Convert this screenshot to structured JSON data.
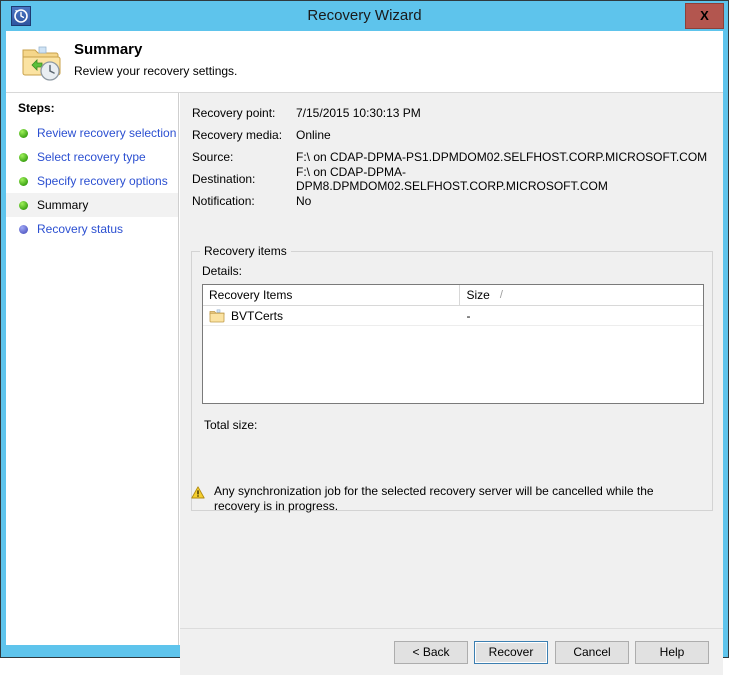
{
  "window": {
    "title": "Recovery Wizard",
    "title_icon": "recovery-clock-icon",
    "close_label": "X",
    "titlebar_color": "#5ec4ec"
  },
  "header": {
    "icon": "folder-recovery-icon",
    "title": "Summary",
    "subtitle": "Review your recovery settings."
  },
  "sidebar": {
    "heading": "Steps:",
    "items": [
      {
        "label": "Review recovery selection",
        "state": "done"
      },
      {
        "label": "Select recovery type",
        "state": "done"
      },
      {
        "label": "Specify recovery options",
        "state": "done"
      },
      {
        "label": "Summary",
        "state": "current"
      },
      {
        "label": "Recovery status",
        "state": "pending"
      }
    ]
  },
  "summary": {
    "fields": [
      {
        "label": "Recovery point:",
        "value": "7/15/2015 10:30:13 PM"
      },
      {
        "label": "Recovery media:",
        "value": "Online"
      },
      {
        "label": "Source:",
        "value": "F:\\ on CDAP-DPMA-PS1.DPMDOM02.SELFHOST.CORP.MICROSOFT.COM"
      },
      {
        "label": "Destination:",
        "value": "F:\\ on CDAP-DPMA-DPM8.DPMDOM02.SELFHOST.CORP.MICROSOFT.COM"
      },
      {
        "label": "Notification:",
        "value": "No"
      }
    ]
  },
  "recovery_items": {
    "group_title": "Recovery items",
    "details_label": "Details:",
    "columns": [
      "Recovery Items",
      "Size"
    ],
    "sort_indicator": "/",
    "rows": [
      {
        "name": "BVTCerts",
        "size": "-",
        "icon": "folder-icon"
      }
    ],
    "total_size_label": "Total size:",
    "total_size_value": ""
  },
  "warning": {
    "icon": "warning-triangle-icon",
    "text": "Any synchronization job for the selected recovery server will be cancelled while the recovery is in progress."
  },
  "footer": {
    "back": "< Back",
    "recover": "Recover",
    "cancel": "Cancel",
    "help": "Help"
  }
}
